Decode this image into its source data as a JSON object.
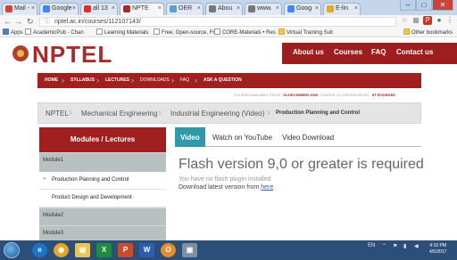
{
  "browser": {
    "tabs": [
      {
        "label": "Mail -",
        "favicon_color": "#d04437"
      },
      {
        "label": "Google",
        "favicon_color": "#4285f4"
      },
      {
        "label": "all 13",
        "favicon_color": "#e52d27"
      },
      {
        "label": "NPTE",
        "favicon_color": "#a82a2a",
        "active": true
      },
      {
        "label": "OER",
        "favicon_color": "#5aa0d8"
      },
      {
        "label": "Abou",
        "favicon_color": "#777777"
      },
      {
        "label": "www.",
        "favicon_color": "#777777"
      },
      {
        "label": "Goog",
        "favicon_color": "#4285f4"
      },
      {
        "label": "E-lin",
        "favicon_color": "#e2a92b"
      }
    ],
    "window_controls": {
      "minimize": "–",
      "maximize": "□",
      "close": "✕"
    },
    "url": "nptel.ac.in/courses/112107143/",
    "bookmarks": [
      "Apps",
      "AcademicPub - Chan",
      "Learning Materials",
      "Free, Open-source, Fr",
      "CORE-Materials • Res",
      "Virtual Training Suit"
    ],
    "other_bookmarks": "Other bookmarks"
  },
  "site": {
    "logo": "NPTEL",
    "nav": [
      "About us",
      "Courses",
      "FAQ",
      "Contact us"
    ],
    "redbar": [
      "HOME",
      "SYLLABUS",
      "LECTURES",
      "DOWNLOADS",
      "FAQ",
      "ASK A QUESTION"
    ],
    "availability": {
      "prefix": "COURSE AVAILABLE FROM :",
      "date": "31-DECEMBER-2009",
      "coord_label": "COURSE CO-ORDINATED BY :",
      "coord": "IIT ROORKEE"
    },
    "breadcrumb": [
      "NPTEL",
      "Mechanical Engineering",
      "Industrial Engineering (Video)",
      "Production Planning and Control"
    ]
  },
  "modules": {
    "header": "Modules / Lectures",
    "items": [
      {
        "label": "Module1"
      },
      {
        "label": "Module2"
      },
      {
        "label": "Module3"
      }
    ],
    "lessons": [
      "Production Planning and Control",
      "Product Design and Development"
    ],
    "bullet": "»"
  },
  "content": {
    "tabs": [
      "Video",
      "Watch on YouTube",
      "Video Download"
    ],
    "flash_title": "Flash version 9,0 or greater is required",
    "flash_sub": "You have no flash plugin installed",
    "flash_dl_prefix": "Download latest version from",
    "flash_dl_link": "here"
  },
  "taskbar": {
    "apps": [
      {
        "label": "e",
        "color": "#1d73c9"
      },
      {
        "label": "◉",
        "color": "#e5a52a"
      },
      {
        "label": "▤",
        "color": "#e7c55a"
      },
      {
        "label": "X",
        "color": "#1e8b3e"
      },
      {
        "label": "P",
        "color": "#c94a2c"
      },
      {
        "label": "W",
        "color": "#2b5fae"
      },
      {
        "label": "O",
        "color": "#e88b2a"
      },
      {
        "label": "▣",
        "color": "#7d8fa3"
      }
    ],
    "tray_text": "EN",
    "time": "4:10 PM",
    "date": "4/5/2017"
  }
}
